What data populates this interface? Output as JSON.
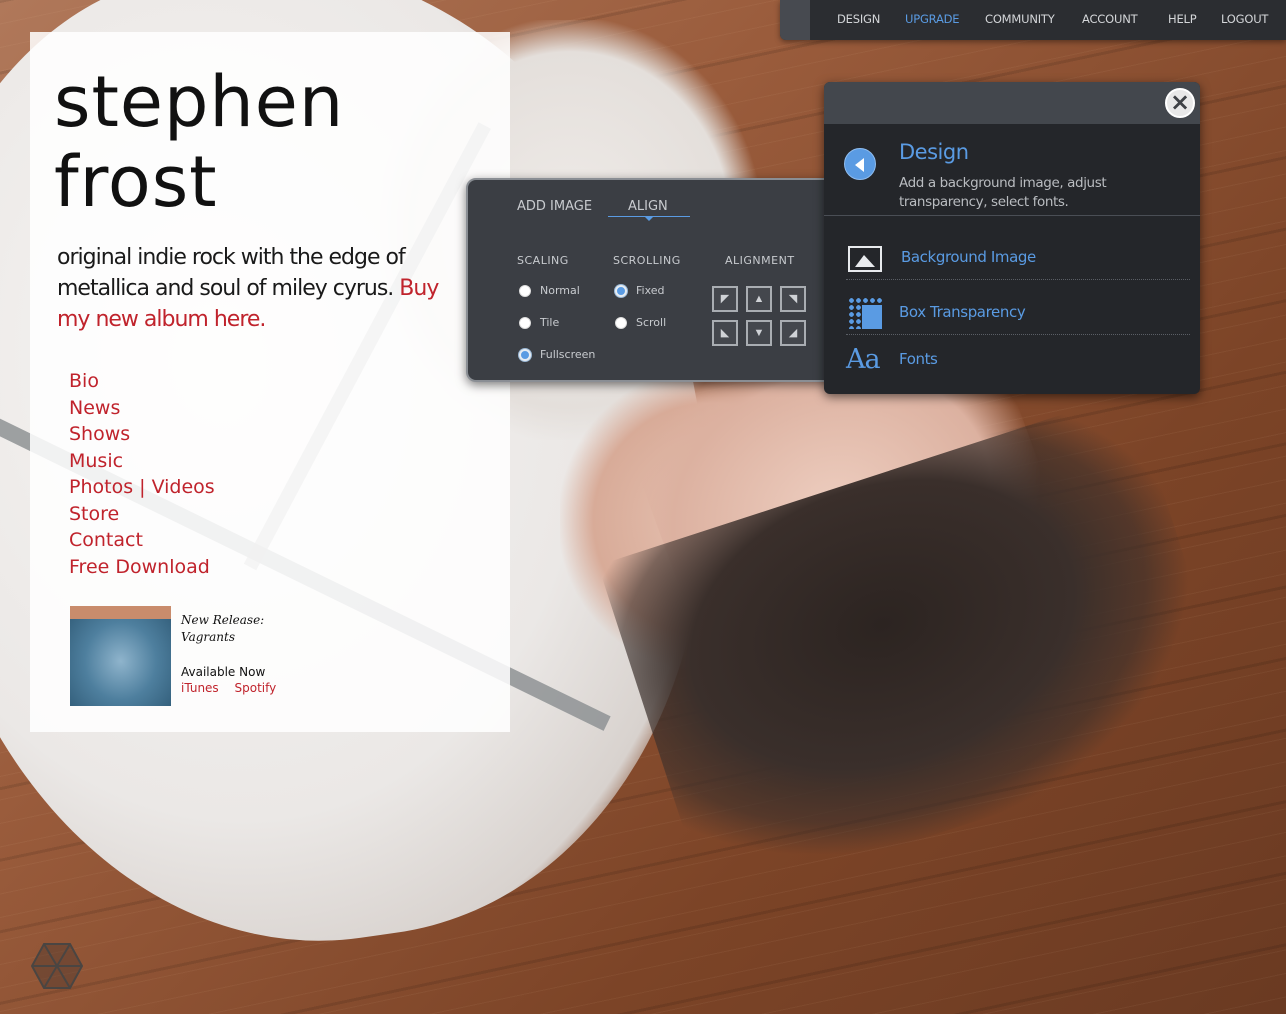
{
  "site": {
    "title_line1": "stephen",
    "title_line2": "frost",
    "tagline": "original indie rock with the edge of metallica and soul of miley cyrus.",
    "tagline_link": "Buy my new album here.",
    "nav": [
      "Bio",
      "News",
      "Shows",
      "Music",
      "Photos | Videos",
      "Store",
      "Contact",
      "Free Download"
    ],
    "release": {
      "label": "New Release:",
      "album": "Vagrants",
      "availability": "Available Now",
      "links": [
        "iTunes",
        "Spotify"
      ]
    }
  },
  "topbar": {
    "items": [
      "DESIGN",
      "UPGRADE",
      "COMMUNITY",
      "ACCOUNT",
      "HELP",
      "LOGOUT"
    ],
    "active": "UPGRADE"
  },
  "align_panel": {
    "tabs": [
      "ADD IMAGE",
      "ALIGN"
    ],
    "active_tab": "ALIGN",
    "scaling": {
      "heading": "SCALING",
      "options": [
        "Normal",
        "Tile",
        "Fullscreen"
      ],
      "selected": "Fullscreen"
    },
    "scrolling": {
      "heading": "SCROLLING",
      "options": [
        "Fixed",
        "Scroll"
      ],
      "selected": "Fixed"
    },
    "alignment": {
      "heading": "ALIGNMENT"
    }
  },
  "design_panel": {
    "title": "Design",
    "description": "Add a background image, adjust transparency, select fonts.",
    "items": [
      "Background Image",
      "Box Transparency",
      "Fonts"
    ],
    "close_icon": "close-icon",
    "back_icon": "back-arrow-icon"
  },
  "colors": {
    "accent": "#5a9be3",
    "link_red": "#c0232c",
    "panel_dark": "#24262a"
  }
}
